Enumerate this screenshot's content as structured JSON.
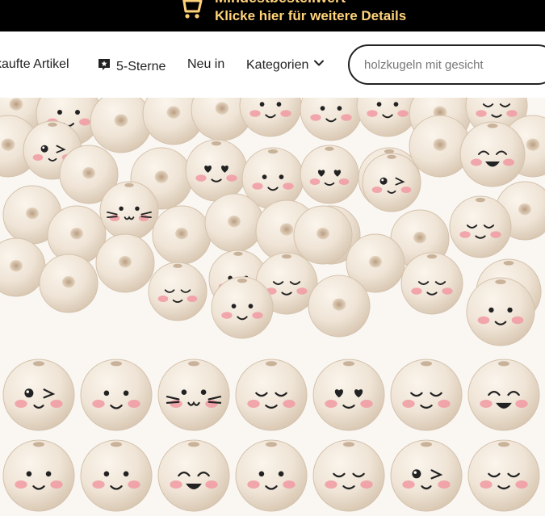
{
  "promo": {
    "title": "Mindestbestellwert",
    "subtitle": "Klicke hier für weitere Details",
    "icon": "shopping-cart-icon",
    "text_color": "#ffd27a",
    "background": "#000000"
  },
  "nav": {
    "items": [
      {
        "label": "kaufte Artikel",
        "icon": ""
      },
      {
        "label": "5-Sterne",
        "icon": "star-badge-icon"
      },
      {
        "label": "Neu in",
        "icon": ""
      },
      {
        "label": "Kategorien",
        "icon": "chevron-down-icon"
      }
    ]
  },
  "search": {
    "placeholder": "holzkugeln mit gesicht",
    "value": ""
  },
  "product": {
    "alt": "holzkugeln mit gesicht",
    "bead_color": "#efe4d6",
    "blush_color": "#f19aa3"
  }
}
